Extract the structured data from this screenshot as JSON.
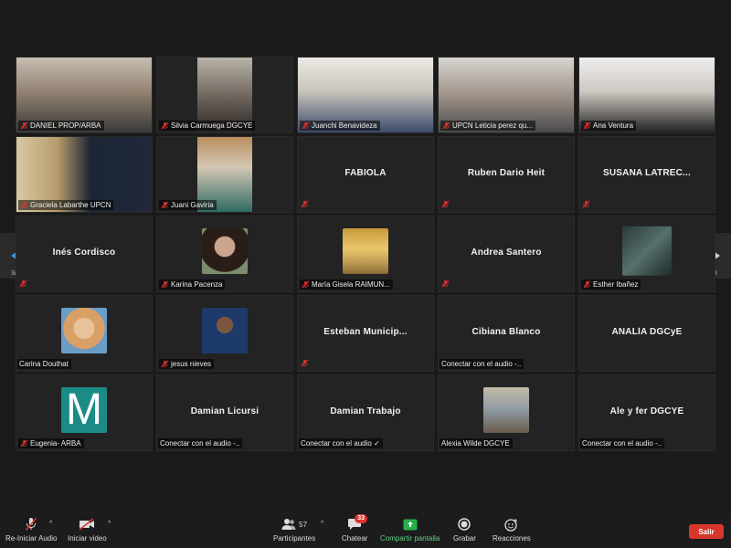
{
  "nav": {
    "page_left": "3/3",
    "page_right": "3/3"
  },
  "colors": {
    "mute_red": "#e0322e",
    "share_green": "#23b04a",
    "leave_red": "#d9362b",
    "nav_arrow": "#3a8fd8"
  },
  "participants": [
    {
      "name": "DANIEL PROP/ARBA",
      "muted": true,
      "center": ""
    },
    {
      "name": "Silvia Carmuega DGCYE",
      "muted": true,
      "center": ""
    },
    {
      "name": "Juanchi Benavideza",
      "muted": true,
      "center": ""
    },
    {
      "name": "UPCN Leticia perez qu...",
      "muted": true,
      "center": ""
    },
    {
      "name": "Ana Ventura",
      "muted": true,
      "center": ""
    },
    {
      "name": "Graciela Labarthe UPCN",
      "muted": true,
      "center": ""
    },
    {
      "name": "Juani Gaviria",
      "muted": true,
      "center": ""
    },
    {
      "name": "",
      "muted": true,
      "center": "FABIOLA"
    },
    {
      "name": "",
      "muted": true,
      "center": "Ruben Dario Heit"
    },
    {
      "name": "",
      "muted": true,
      "center": "SUSANA LATREC..."
    },
    {
      "name": "",
      "muted": true,
      "center": "Inés Cordisco"
    },
    {
      "name": "Karina Pacenza",
      "muted": true,
      "center": ""
    },
    {
      "name": "María Gisela RAIMUN...",
      "muted": true,
      "center": ""
    },
    {
      "name": "",
      "muted": true,
      "center": "Andrea Santero"
    },
    {
      "name": "Esther Ibañez",
      "muted": true,
      "center": ""
    },
    {
      "name": "Carina Douthat",
      "muted": false,
      "center": ""
    },
    {
      "name": "jesus nieves",
      "muted": true,
      "center": ""
    },
    {
      "name": "",
      "muted": true,
      "center": "Esteban Municip..."
    },
    {
      "name": "Conectar con el audio -..",
      "muted": false,
      "center": "Cibiana Blanco"
    },
    {
      "name": "",
      "muted": false,
      "center": "ANALÍA DGCyE"
    },
    {
      "name": "Eugenia- ARBA",
      "muted": true,
      "center": ""
    },
    {
      "name": "Conectar con el audio -..",
      "muted": false,
      "center": "Damian Licursi"
    },
    {
      "name": "Conectar con el audio ✓",
      "muted": false,
      "center": "Damian Trabajo"
    },
    {
      "name": "Alexia Wilde DGCYE",
      "muted": false,
      "center": ""
    },
    {
      "name": "Conectar con el audio -..",
      "muted": false,
      "center": "Ale y fer DGCYE"
    }
  ],
  "avatar_letter": "M",
  "toolbar": {
    "audio": "Re-Iniciar Audio",
    "video": "Iniciar video",
    "participants": "Participantes",
    "participants_count": "57",
    "chat": "Chatear",
    "chat_badge": "33",
    "share": "Compartir pantalla",
    "record": "Grabar",
    "reactions": "Reacciones",
    "leave": "Salir"
  }
}
